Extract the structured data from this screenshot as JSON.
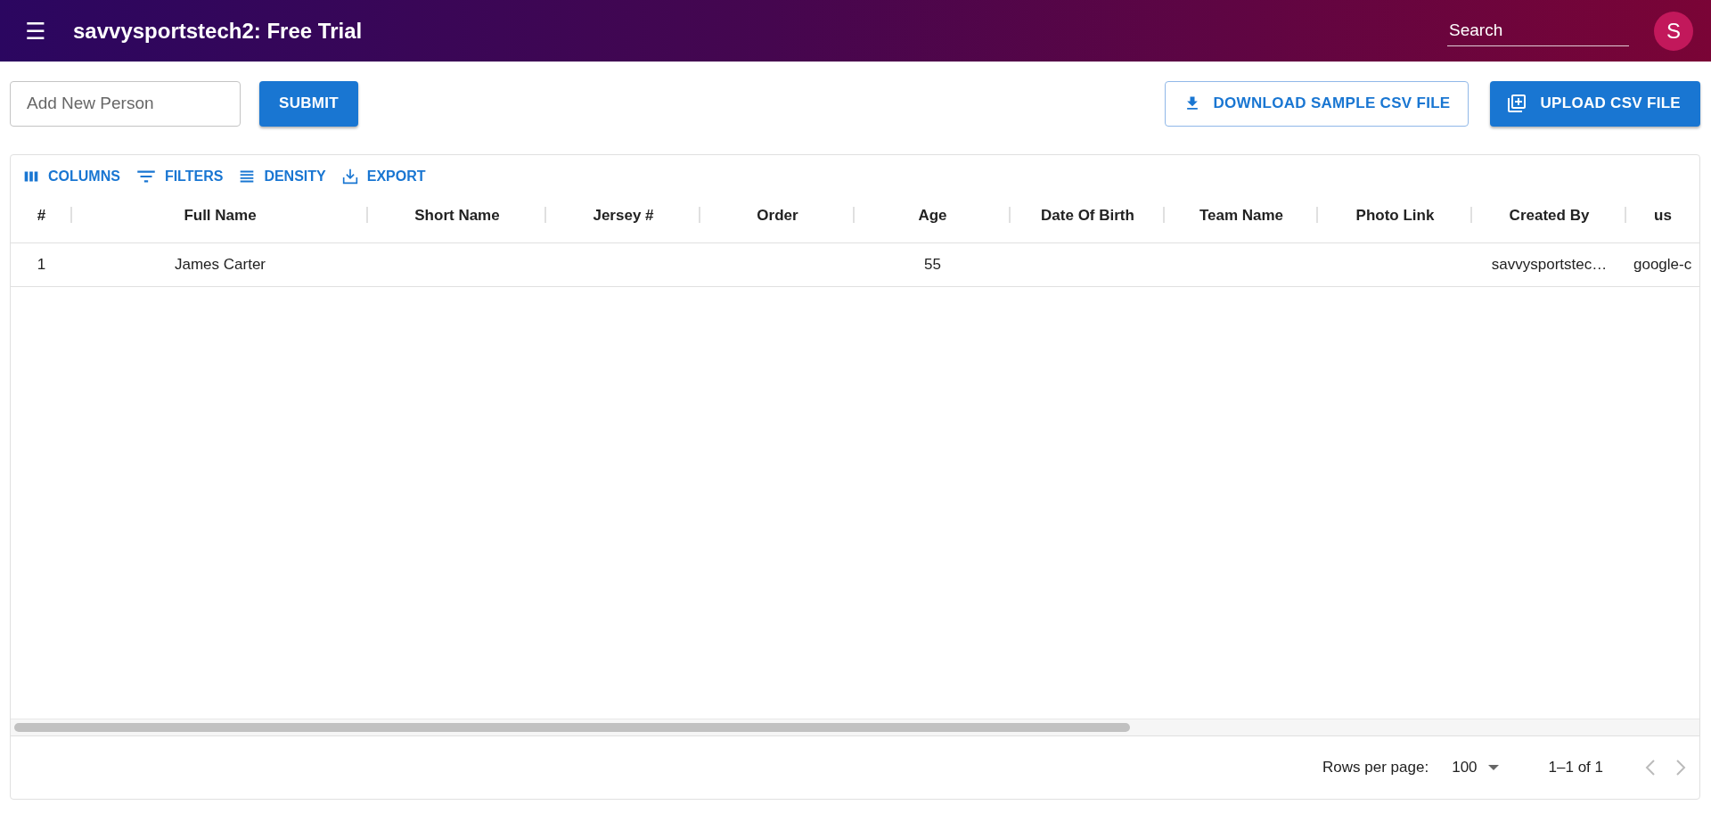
{
  "app_bar": {
    "menu_icon": "☰",
    "title": "savvysportstech2: Free Trial",
    "search": {
      "placeholder": "Search"
    },
    "avatar": "S"
  },
  "actions": {
    "new_person": {
      "placeholder": "Add New Person"
    },
    "submit": "SUBMIT",
    "download": "DOWNLOAD SAMPLE CSV FILE",
    "upload": "UPLOAD CSV FILE"
  },
  "grid_toolbar": [
    {
      "kind": "columns",
      "label": "COLUMNS"
    },
    {
      "kind": "filters",
      "label": "FILTERS"
    },
    {
      "kind": "density",
      "label": "DENSITY"
    },
    {
      "kind": "export",
      "label": "EXPORT"
    }
  ],
  "table": {
    "columns": [
      "#",
      "Full Name",
      "Short Name",
      "Jersey #",
      "Order",
      "Age",
      "Date Of Birth",
      "Team Name",
      "Photo Link",
      "Created By",
      "us"
    ],
    "rows": [
      [
        "1",
        "James Carter",
        null,
        null,
        null,
        "55",
        null,
        null,
        null,
        "savvysportstec…",
        "google-c"
      ]
    ]
  },
  "footer": {
    "rows_per_page_label": "Rows per page:",
    "rows_per_page": "100",
    "range": "1–1 of 1"
  }
}
